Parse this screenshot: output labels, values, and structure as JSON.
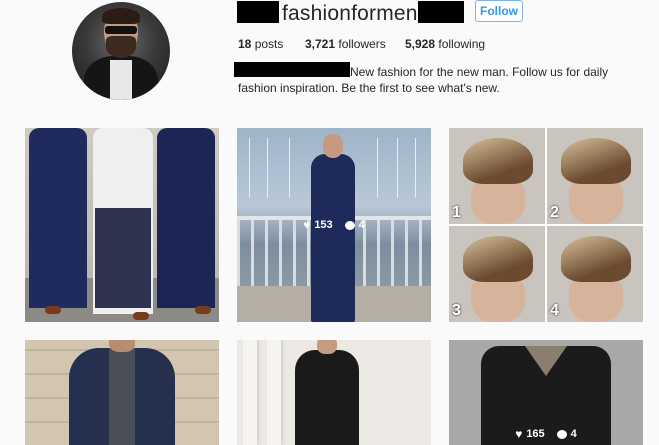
{
  "profile": {
    "username": "fashionformen",
    "follow_label": "Follow",
    "stats": {
      "posts_count": "18",
      "posts_label": "posts",
      "followers_count": "3,721",
      "followers_label": "followers",
      "following_count": "5,928",
      "following_label": "following"
    },
    "bio_line": "New fashion for the new man. Follow us for daily fashion inspiration. Be the first to see what's new."
  },
  "posts": [
    {
      "likes": "",
      "comments": ""
    },
    {
      "likes": "153",
      "comments": "4"
    },
    {
      "likes": "",
      "comments": "",
      "labels": [
        "1",
        "2",
        "3",
        "4"
      ]
    },
    {
      "likes": "",
      "comments": ""
    },
    {
      "likes": "",
      "comments": ""
    },
    {
      "likes": "165",
      "comments": "4"
    }
  ],
  "colors": {
    "follow_blue": "#3897f0",
    "text": "#262626",
    "background": "#fafafa"
  }
}
